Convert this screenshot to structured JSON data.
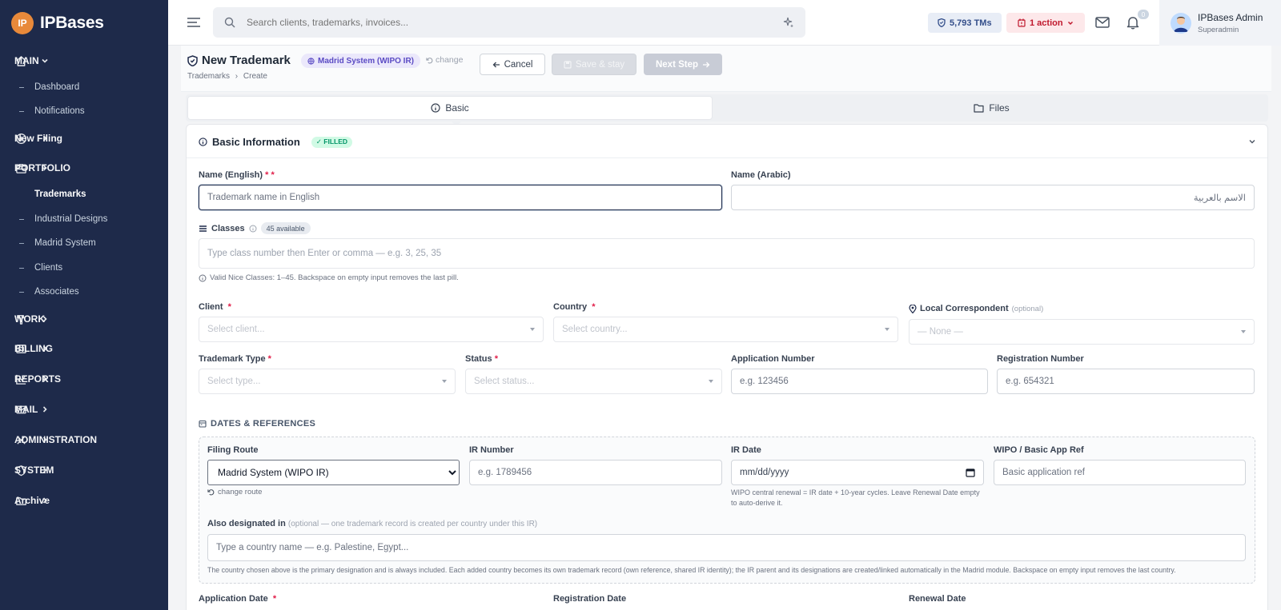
{
  "brand": {
    "name": "IPBases",
    "logo_letters": "IP"
  },
  "sidebar": {
    "groups": [
      {
        "key": "main",
        "label": "MAIN",
        "icon": "home-icon",
        "expanded": true
      },
      {
        "key": "new_filing",
        "label": "New Filing",
        "icon": "plus-circle-icon"
      },
      {
        "key": "portfolio",
        "label": "PORTFOLIO",
        "icon": "briefcase-icon"
      },
      {
        "key": "work",
        "label": "WORK",
        "icon": "gavel-icon"
      },
      {
        "key": "billing",
        "label": "BILLING",
        "icon": "billing-icon"
      },
      {
        "key": "reports",
        "label": "REPORTS",
        "icon": "chart-line-icon"
      },
      {
        "key": "mail",
        "label": "MAIL",
        "icon": "mail-icon"
      },
      {
        "key": "administration",
        "label": "ADMINISTRATION",
        "icon": "tools-icon"
      },
      {
        "key": "system",
        "label": "SYSTEM",
        "icon": "shield-icon"
      },
      {
        "key": "archive",
        "label": "Archive",
        "icon": "folder-icon"
      }
    ],
    "main_items": [
      "Dashboard",
      "Notifications"
    ],
    "portfolio_items": [
      "Trademarks",
      "Industrial Designs",
      "Madrid System",
      "Clients",
      "Associates"
    ],
    "active_item": "Trademarks"
  },
  "topbar": {
    "search_placeholder": "Search clients, trademarks, invoices...",
    "tms_count": "5,793 TMs",
    "action_count": "1 action",
    "notification_count": "0",
    "user_name": "IPBases Admin",
    "user_role": "Superadmin"
  },
  "header": {
    "title": "New Trademark",
    "route_badge": "Madrid System (WIPO IR)",
    "change_label": "change",
    "breadcrumb": [
      "Trademarks",
      "Create"
    ],
    "cancel_label": "Cancel",
    "save_label": "Save & stay",
    "next_label": "Next Step"
  },
  "tabs": [
    {
      "label": "Basic",
      "active": true
    },
    {
      "label": "Files",
      "active": false
    }
  ],
  "card": {
    "title": "Basic Information",
    "status_badge": "✓ FILLED"
  },
  "form": {
    "name_en": {
      "label": "Name (English)",
      "req": "* *",
      "placeholder": "Trademark name in English",
      "value": ""
    },
    "name_ar": {
      "label": "Name (Arabic)",
      "placeholder": "الاسم بالعربية",
      "value": ""
    },
    "classes": {
      "label": "Classes",
      "badge": "45 available",
      "placeholder": "Type class number then Enter or comma — e.g. 3, 25, 35",
      "hint": "Valid Nice Classes: 1–45. Backspace on empty input removes the last pill."
    },
    "client": {
      "label": "Client",
      "req": "*",
      "placeholder": "Select client..."
    },
    "country": {
      "label": "Country",
      "req": "*",
      "placeholder": "Select country..."
    },
    "local_correspondent": {
      "label": "Local Correspondent",
      "optional": "(optional)",
      "placeholder": "— None —"
    },
    "trademark_type": {
      "label": "Trademark Type",
      "req": "*",
      "placeholder": "Select type..."
    },
    "status": {
      "label": "Status",
      "req": "*",
      "placeholder": "Select status..."
    },
    "application_number": {
      "label": "Application Number",
      "placeholder": "e.g. 123456"
    },
    "registration_number": {
      "label": "Registration Number",
      "placeholder": "e.g. 654321"
    },
    "dates_section": "DATES & REFERENCES",
    "filing_route": {
      "label": "Filing Route",
      "value": "Madrid System (WIPO IR)",
      "change_link": "change route"
    },
    "ir_number": {
      "label": "IR Number",
      "placeholder": "e.g. 1789456"
    },
    "ir_date": {
      "label": "IR Date",
      "placeholder": "mm/dd/yyyy",
      "hint": "WIPO central renewal = IR date + 10-year cycles. Leave Renewal Date empty to auto-derive it."
    },
    "wipo_ref": {
      "label": "WIPO / Basic App Ref",
      "placeholder": "Basic application ref"
    },
    "designated": {
      "label": "Also designated in",
      "optional": "(optional — one trademark record is created per country under this IR)",
      "placeholder": "Type a country name — e.g. Palestine, Egypt...",
      "hint": "The country chosen above is the primary designation and is always included. Each added country becomes its own trademark record (own reference, shared IR identity); the IR parent and its designations are created/linked automatically in the Madrid module. Backspace on empty input removes the last country."
    },
    "application_date": {
      "label": "Application Date",
      "req": "*"
    },
    "registration_date": {
      "label": "Registration Date"
    },
    "renewal_date": {
      "label": "Renewal Date"
    }
  }
}
